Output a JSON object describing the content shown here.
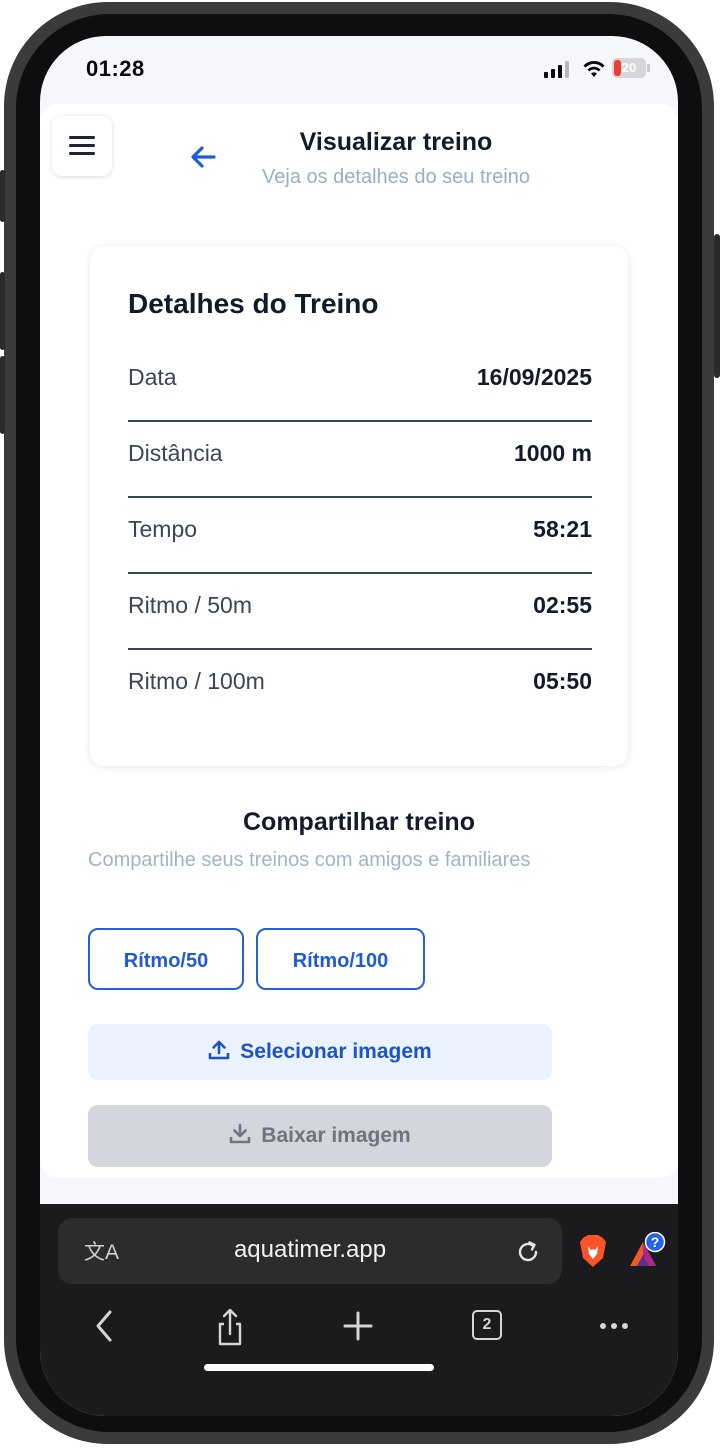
{
  "status_bar": {
    "time": "01:28",
    "battery": "20"
  },
  "header": {
    "title": "Visualizar treino",
    "subtitle": "Veja os detalhes do seu treino"
  },
  "details": {
    "title": "Detalhes do Treino",
    "rows": [
      {
        "label": "Data",
        "value": "16/09/2025"
      },
      {
        "label": "Distância",
        "value": "1000 m"
      },
      {
        "label": "Tempo",
        "value": "58:21"
      },
      {
        "label": "Ritmo / 50m",
        "value": "02:55"
      },
      {
        "label": "Ritmo / 100m",
        "value": "05:50"
      }
    ]
  },
  "share": {
    "title": "Compartilhar treino",
    "subtitle": "Compartilhe seus treinos com amigos e familiares",
    "chips": [
      "Rítmo/50",
      "Rítmo/100"
    ],
    "select_image": "Selecionar imagem",
    "download_image": "Baixar imagem"
  },
  "browser": {
    "url": "aquatimer.app",
    "translate_icon": "translate-icon",
    "tabs_count": "2",
    "rewards_badge": "?"
  },
  "colors": {
    "accent": "#1f5bd6",
    "title": "#121a2b",
    "muted": "#9aaec4",
    "disabled_bg": "#d3d6dc"
  }
}
